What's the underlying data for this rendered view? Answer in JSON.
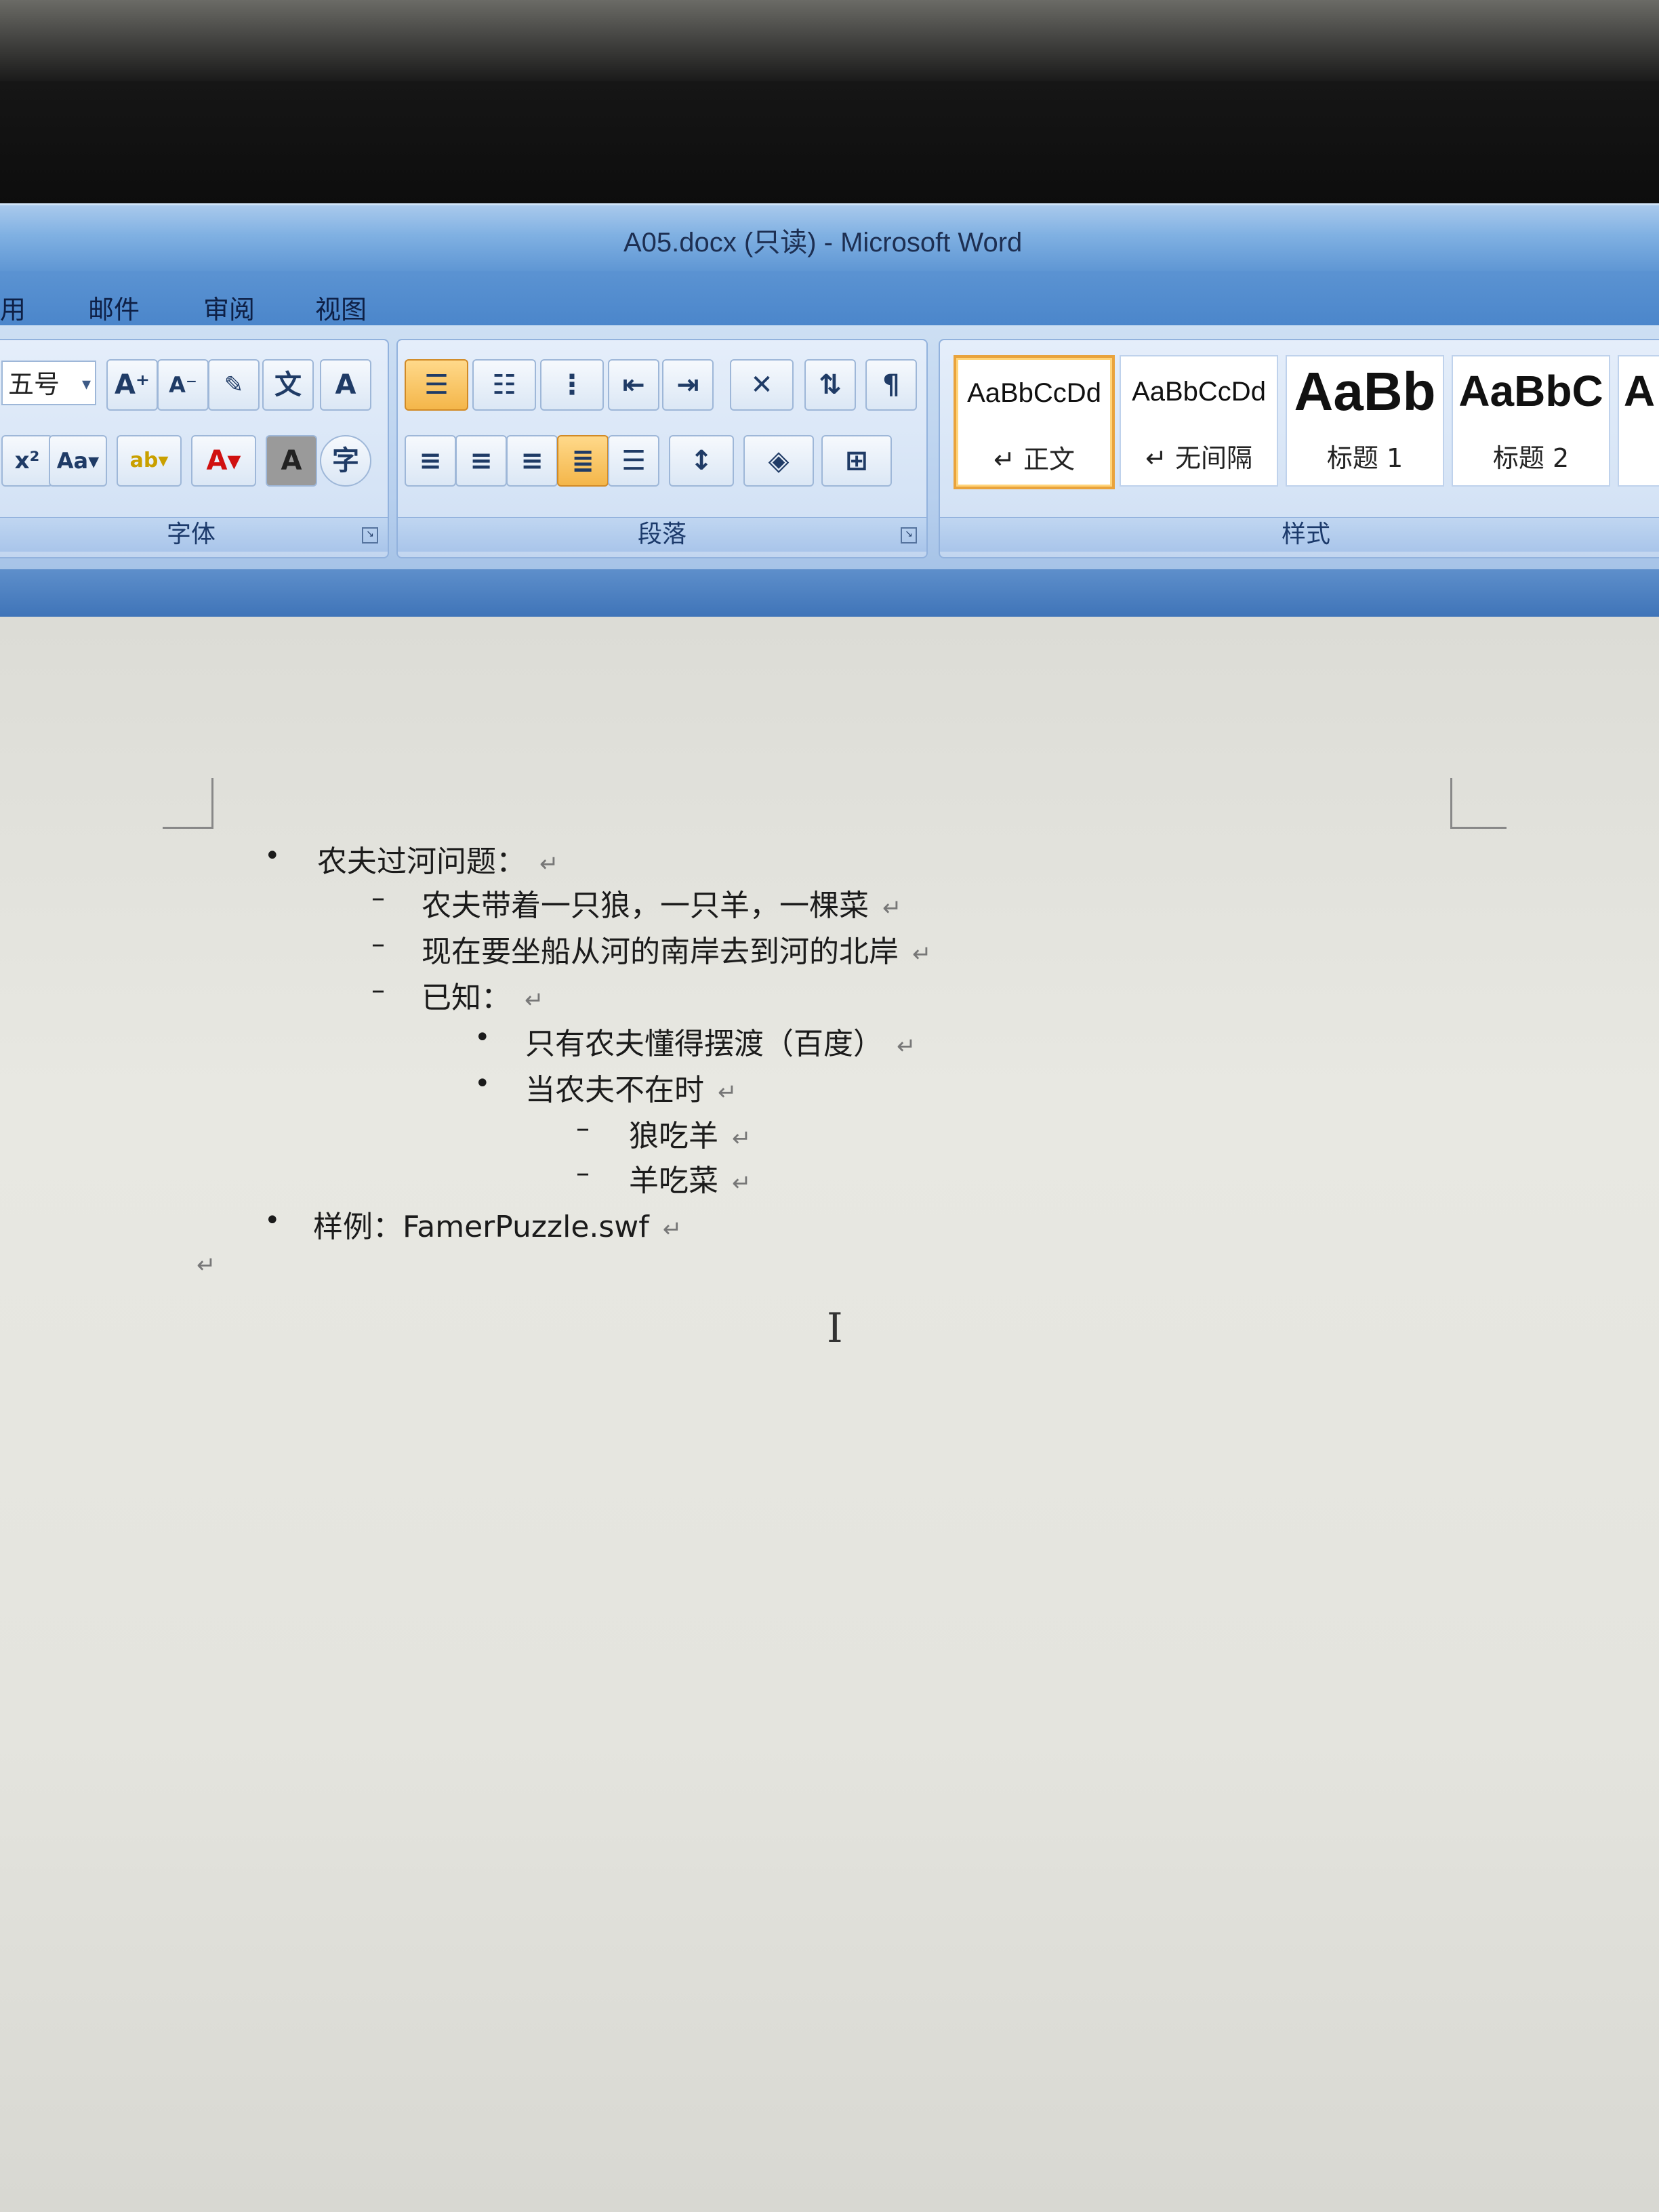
{
  "window": {
    "title": "A05.docx (只读) - Microsoft Word"
  },
  "menu": {
    "tabs": [
      "用",
      "邮件",
      "审阅",
      "视图"
    ]
  },
  "ribbon": {
    "font": {
      "size_value": "五号",
      "label": "字体"
    },
    "paragraph": {
      "label": "段落"
    },
    "styles": {
      "label": "样式",
      "items": [
        {
          "sample": "AaBbCcDd",
          "name": "↵ 正文"
        },
        {
          "sample": "AaBbCcDd",
          "name": "↵ 无间隔"
        },
        {
          "sample": "AaBb",
          "name": "标题 1"
        },
        {
          "sample": "AaBbC",
          "name": "标题 2"
        },
        {
          "sample": "A",
          "name": ""
        }
      ]
    }
  },
  "document": {
    "paragraph_mark": "↵",
    "lines": [
      {
        "marker": "•",
        "text": "农夫过河问题："
      },
      {
        "marker": "–",
        "text": "农夫带着一只狼，一只羊，一棵菜"
      },
      {
        "marker": "–",
        "text": "现在要坐船从河的南岸去到河的北岸"
      },
      {
        "marker": "–",
        "text": "已知："
      },
      {
        "marker": "•",
        "text": "只有农夫懂得摆渡（百度）"
      },
      {
        "marker": "•",
        "text": "当农夫不在时"
      },
      {
        "marker": "–",
        "text": "狼吃羊"
      },
      {
        "marker": "–",
        "text": "羊吃菜"
      },
      {
        "marker": "•",
        "text": "样例：FamerPuzzle.swf"
      }
    ]
  }
}
